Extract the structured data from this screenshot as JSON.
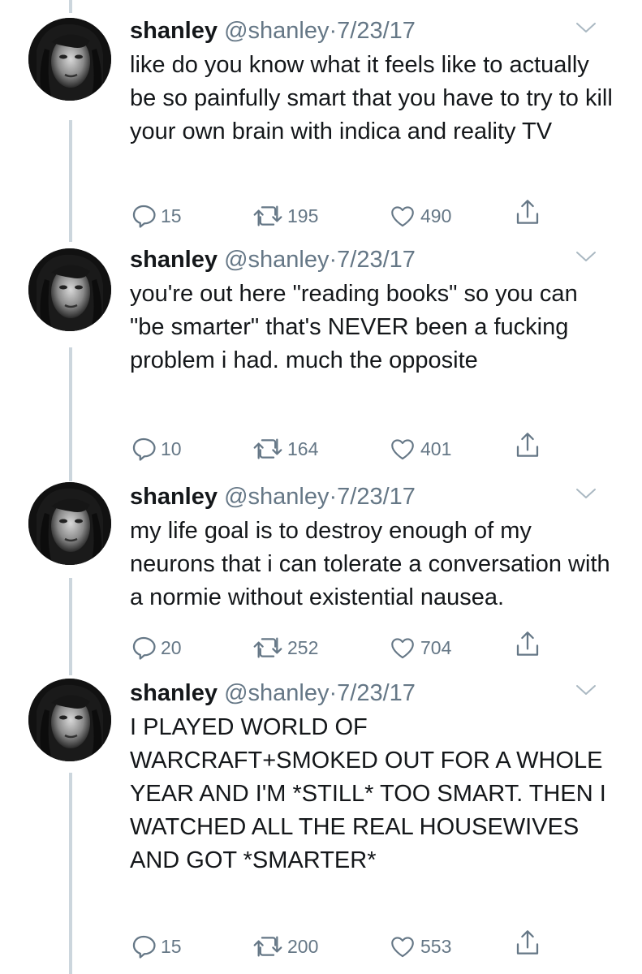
{
  "tweets": [
    {
      "name": "shanley",
      "handle": "@shanley",
      "dot": "·",
      "date": "7/23/17",
      "text": "like do you know what it feels like to actually be so painfully smart that you have to try to kill your own brain with indica and reality TV",
      "replies": "15",
      "retweets": "195",
      "likes": "490"
    },
    {
      "name": "shanley",
      "handle": "@shanley",
      "dot": "·",
      "date": "7/23/17",
      "text": "you're out here \"reading books\" so you can \"be smarter\" that's NEVER been a fucking problem i had. much the opposite",
      "replies": "10",
      "retweets": "164",
      "likes": "401"
    },
    {
      "name": "shanley",
      "handle": "@shanley",
      "dot": "·",
      "date": "7/23/17",
      "text": "my life goal is to destroy enough of my neurons that i can tolerate a conversation with a normie without existential nausea.",
      "replies": "20",
      "retweets": "252",
      "likes": "704"
    },
    {
      "name": "shanley",
      "handle": "@shanley",
      "dot": "·",
      "date": "7/23/17",
      "text": "I PLAYED WORLD OF WARCRAFT+SMOKED OUT FOR A WHOLE YEAR AND I'M *STILL* TOO SMART. THEN I WATCHED ALL THE REAL HOUSEWIVES AND GOT *SMARTER*",
      "replies": "15",
      "retweets": "200",
      "likes": "553"
    }
  ],
  "colors": {
    "text": "#14171a",
    "secondary": "#657786",
    "thread_line": "#ccd6dd"
  },
  "icons": [
    "reply-icon",
    "retweet-icon",
    "like-icon",
    "share-icon",
    "chevron-down-icon"
  ]
}
